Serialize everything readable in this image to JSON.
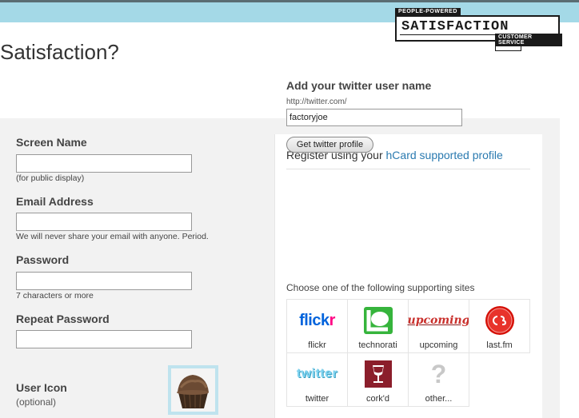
{
  "header": {
    "logo": {
      "tagline": "PEOPLE-POWERED",
      "name": "SATISFACTION",
      "subline": "CUSTOMER SERVICE"
    }
  },
  "page_title": "Satisfaction?",
  "twitter": {
    "heading": "Add your twitter user name",
    "url_prefix": "http://twitter.com/",
    "username_value": "factoryjoe",
    "button_label": "Get twitter profile"
  },
  "register": {
    "text": "Register using your",
    "link": "hCard supported profile"
  },
  "choose_text": "Choose one of the following supporting sites",
  "sites": [
    {
      "label": "flickr",
      "icon": "flickr-icon"
    },
    {
      "label": "technorati",
      "icon": "technorati-icon"
    },
    {
      "label": "upcoming",
      "icon": "upcoming-icon"
    },
    {
      "label": "last.fm",
      "icon": "lastfm-icon"
    },
    {
      "label": "twitter",
      "icon": "twitter-icon"
    },
    {
      "label": "cork'd",
      "icon": "corkd-icon"
    },
    {
      "label": "other...",
      "icon": "question-icon"
    }
  ],
  "site_logos": {
    "flickr": "flickr",
    "upcoming": "upcoming",
    "twitter": "twitter",
    "other": "?"
  },
  "form": {
    "screen_name": {
      "label": "Screen Name",
      "value": "",
      "hint": "(for public display)"
    },
    "email": {
      "label": "Email Address",
      "value": "",
      "hint": "We will never share your email with anyone. Period."
    },
    "password": {
      "label": "Password",
      "value": "",
      "hint": "7 characters or more"
    },
    "repeat_password": {
      "label": "Repeat Password",
      "value": ""
    },
    "user_icon": {
      "label": "User Icon",
      "hint": "(optional)"
    }
  },
  "colors": {
    "topbar": "#a4d9e7",
    "link": "#2a7ab0",
    "panel_bg": "#f2f2f2"
  }
}
